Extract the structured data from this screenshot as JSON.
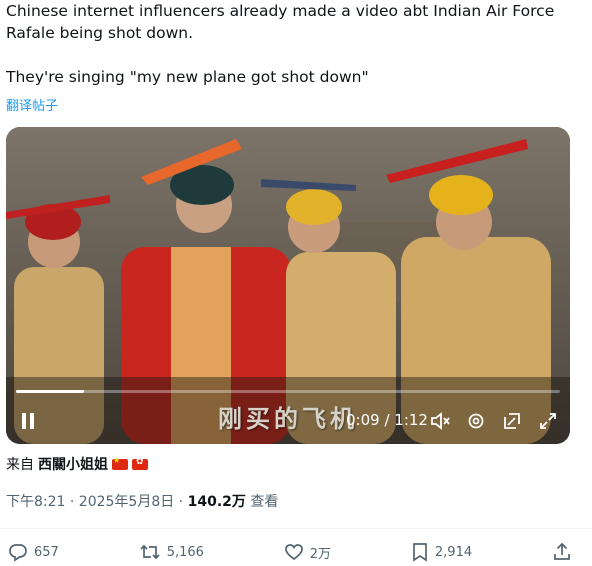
{
  "tweet": {
    "line1": "Chinese internet influencers already made a video abt Indian Air Force",
    "line2": "Rafale being shot down.",
    "line3": "They're singing \"my new plane got shot down\"",
    "translate": "翻译帖子"
  },
  "video": {
    "subtitle": "刚买的飞机",
    "time": "0:09 / 1:12",
    "progress": 0.125,
    "icons": [
      "pause-icon",
      "mute-icon",
      "settings-icon",
      "pip-icon",
      "fullscreen-icon"
    ]
  },
  "source": {
    "prefix": "来自",
    "handle": "西關小姐姐"
  },
  "meta": {
    "timestamp": "下午8:21 · 2025年5月8日 · ",
    "views": "140.2万",
    "views_label": " 查看"
  },
  "actions": {
    "replies": "657",
    "reposts": "5,166",
    "likes": "2万",
    "bookmarks": "2,914"
  },
  "colors": {
    "link": "#1d9bf0",
    "muted": "#536471"
  }
}
